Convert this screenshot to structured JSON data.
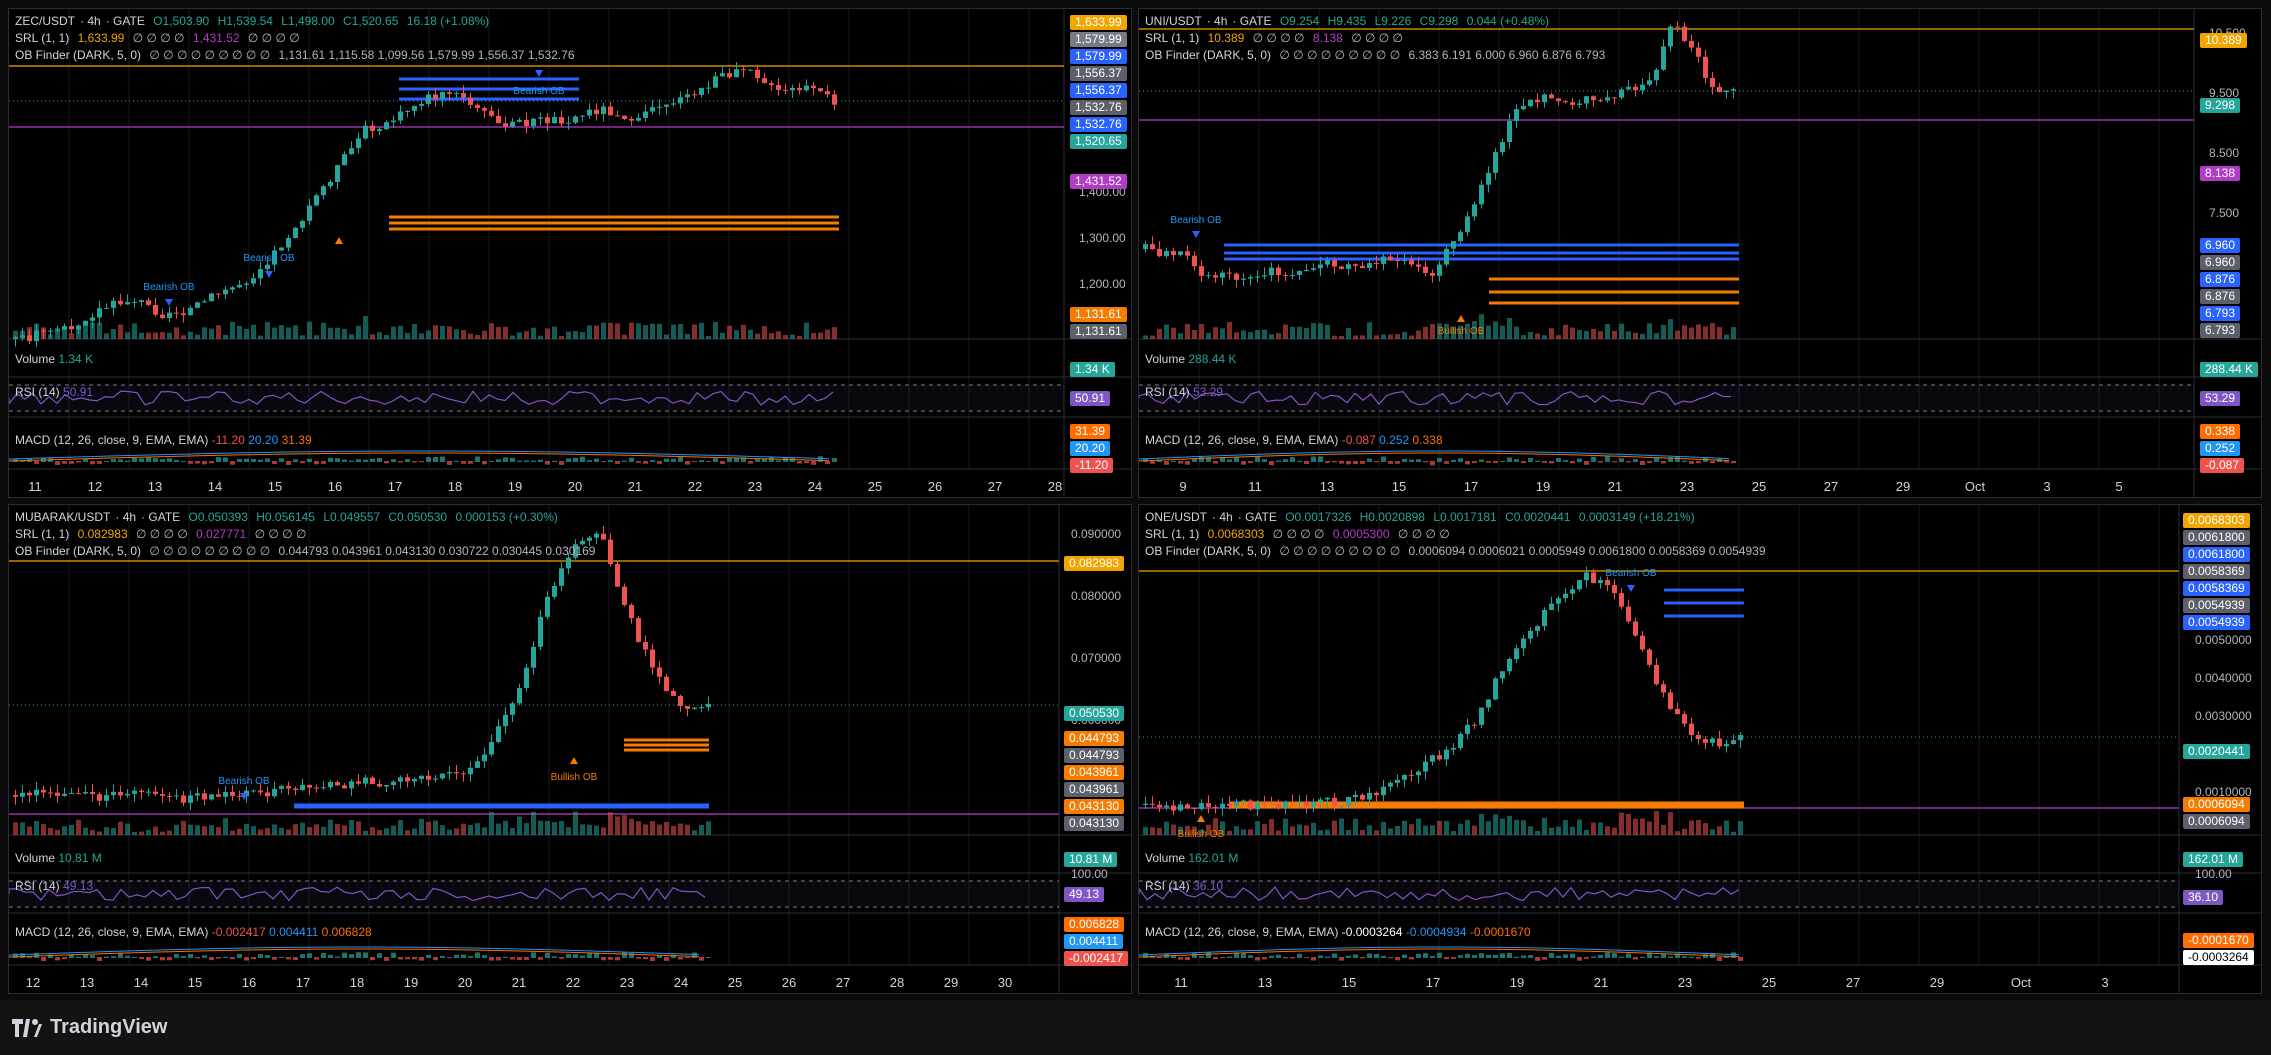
{
  "footer": {
    "brand": "TradingView"
  },
  "colors": {
    "up": "#26a69a",
    "down": "#ef5350",
    "bg": "#000000",
    "srl_top": "#f0a500",
    "srl_bot": "#b23cc8",
    "ob_bear": "#2962ff",
    "ob_bull": "#f57c00",
    "rsi": "#7e57c2",
    "macd": "#2196f3",
    "signal": "#ff6d00"
  },
  "panels": [
    {
      "id": "zec",
      "legend": {
        "symbol": "ZEC/USDT",
        "interval": "4h",
        "exchange": "GATE",
        "o": "O1,503.90",
        "h": "H1,539.54",
        "l": "L1,498.00",
        "c": "C1,520.65",
        "chg": "16.18 (+1.08%)",
        "srl_name": "SRL (1, 1)",
        "srl_v1": "1,633.99",
        "srl_nan1": "∅ ∅ ∅ ∅",
        "srl_v2": "1,431.52",
        "srl_nan2": "∅ ∅ ∅ ∅",
        "ob_name": "OB Finder (DARK, 5, 0)",
        "ob_nans": "∅ ∅ ∅ ∅ ∅ ∅ ∅ ∅ ∅",
        "ob_values": "1,131.61  1,115.58  1,099.56  1,579.99  1,556.37  1,532.76"
      },
      "yticks": [
        "1,400.00",
        "1,300.00",
        "1,200.00"
      ],
      "price_labels": [
        {
          "text": "1,633.99",
          "bg": "#f0a500"
        },
        {
          "text": "1,579.99",
          "bg": "#787b86"
        },
        {
          "text": "1,579.99",
          "bg": "#2962ff"
        },
        {
          "text": "1,556.37",
          "bg": "#5d606b"
        },
        {
          "text": "1,556.37",
          "bg": "#2962ff"
        },
        {
          "text": "1,532.76",
          "bg": "#5d606b"
        },
        {
          "text": "1,532.76",
          "bg": "#2962ff"
        },
        {
          "text": "1,520.65",
          "bg": "#26a69a"
        },
        {
          "text": "1,431.52",
          "bg": "#b23cc8"
        },
        {
          "text": "1,131.61",
          "bg": "#f57c00"
        },
        {
          "text": "1,131.61",
          "bg": "#5d606b"
        }
      ],
      "xticks": [
        "11",
        "12",
        "13",
        "14",
        "15",
        "16",
        "17",
        "18",
        "19",
        "20",
        "21",
        "22",
        "23",
        "24",
        "25",
        "26",
        "27",
        "28"
      ],
      "volume": {
        "name": "Volume",
        "value": "1.34 K",
        "label": "1.34 K"
      },
      "rsi": {
        "name": "RSI (14)",
        "value": "50.91",
        "label": "50.91"
      },
      "macd": {
        "name": "MACD (12, 26, close, 9, EMA, EMA)",
        "v1": "-11.20",
        "v2": "20.20",
        "v3": "31.39",
        "labels": [
          {
            "text": "31.39",
            "bg": "#ff6d00"
          },
          {
            "text": "20.20",
            "bg": "#2196f3"
          },
          {
            "text": "-11.20",
            "bg": "#ef5350"
          }
        ]
      },
      "ob_texts": [
        {
          "text": "Bearish OB",
          "kind": "bear"
        },
        {
          "text": "Bearish OB",
          "kind": "bear"
        },
        {
          "text": "Bearish OB",
          "kind": "bear"
        }
      ]
    },
    {
      "id": "uni",
      "legend": {
        "symbol": "UNI/USDT",
        "interval": "4h",
        "exchange": "GATE",
        "o": "O9.254",
        "h": "H9.435",
        "l": "L9.226",
        "c": "C9.298",
        "chg": "0.044 (+0.48%)",
        "srl_name": "SRL (1, 1)",
        "srl_v1": "10.389",
        "srl_nan1": "∅ ∅ ∅ ∅",
        "srl_v2": "8.138",
        "srl_nan2": "∅ ∅ ∅ ∅",
        "ob_name": "OB Finder (DARK, 5, 0)",
        "ob_nans": "∅ ∅ ∅ ∅ ∅ ∅ ∅ ∅ ∅",
        "ob_values": "6.383  6.191  6.000  6.960  6.876  6.793"
      },
      "yticks": [
        "10.500",
        "9.500",
        "8.500",
        "7.500"
      ],
      "price_labels": [
        {
          "text": "10.389",
          "bg": "#f0a500"
        },
        {
          "text": "9.298",
          "bg": "#26a69a"
        },
        {
          "text": "8.138",
          "bg": "#b23cc8"
        },
        {
          "text": "6.960",
          "bg": "#2962ff"
        },
        {
          "text": "6.960",
          "bg": "#5d606b"
        },
        {
          "text": "6.876",
          "bg": "#2962ff"
        },
        {
          "text": "6.876",
          "bg": "#5d606b"
        },
        {
          "text": "6.793",
          "bg": "#2962ff"
        },
        {
          "text": "6.793",
          "bg": "#5d606b"
        }
      ],
      "xticks": [
        "9",
        "11",
        "13",
        "15",
        "17",
        "19",
        "21",
        "23",
        "25",
        "27",
        "29",
        "Oct",
        "3",
        "5"
      ],
      "volume": {
        "name": "Volume",
        "value": "288.44 K",
        "label": "288.44 K"
      },
      "rsi": {
        "name": "RSI (14)",
        "value": "53.29",
        "label": "53.29"
      },
      "macd": {
        "name": "MACD (12, 26, close, 9, EMA, EMA)",
        "v1": "-0.087",
        "v2": "0.252",
        "v3": "0.338",
        "labels": [
          {
            "text": "0.338",
            "bg": "#ff6d00"
          },
          {
            "text": "0.252",
            "bg": "#2196f3"
          },
          {
            "text": "-0.087",
            "bg": "#ef5350"
          }
        ]
      },
      "ob_texts": [
        {
          "text": "Bearish OB",
          "kind": "bear"
        },
        {
          "text": "Bullish OB",
          "kind": "bull"
        }
      ]
    },
    {
      "id": "mubarak",
      "legend": {
        "symbol": "MUBARAK/USDT",
        "interval": "4h",
        "exchange": "GATE",
        "o": "O0.050393",
        "h": "H0.056145",
        "l": "L0.049557",
        "c": "C0.050530",
        "chg": "0.000153 (+0.30%)",
        "srl_name": "SRL (1, 1)",
        "srl_v1": "0.082983",
        "srl_nan1": "∅ ∅ ∅ ∅",
        "srl_v2": "0.027771",
        "srl_nan2": "∅ ∅ ∅ ∅",
        "ob_name": "OB Finder (DARK, 5, 0)",
        "ob_nans": "∅ ∅ ∅ ∅ ∅ ∅ ∅ ∅ ∅",
        "ob_values": "0.044793  0.043961  0.043130  0.030722  0.030445  0.030169"
      },
      "yticks": [
        "0.090000",
        "0.080000",
        "0.070000",
        "0.060000"
      ],
      "price_labels": [
        {
          "text": "0.082983",
          "bg": "#f0a500"
        },
        {
          "text": "0.050530",
          "bg": "#26a69a"
        },
        {
          "text": "0.044793",
          "bg": "#f57c00"
        },
        {
          "text": "0.044793",
          "bg": "#5d606b"
        },
        {
          "text": "0.043961",
          "bg": "#f57c00"
        },
        {
          "text": "0.043961",
          "bg": "#5d606b"
        },
        {
          "text": "0.043130",
          "bg": "#f57c00"
        },
        {
          "text": "0.043130",
          "bg": "#5d606b"
        }
      ],
      "xticks": [
        "12",
        "13",
        "14",
        "15",
        "16",
        "17",
        "18",
        "19",
        "20",
        "21",
        "22",
        "23",
        "24",
        "25",
        "26",
        "27",
        "28",
        "29",
        "30"
      ],
      "volume": {
        "name": "Volume",
        "value": "10.81 M",
        "label": "10.81 M"
      },
      "rsi": {
        "name": "RSI (14)",
        "value": "49.13",
        "label": "49.13",
        "tick": "100.00"
      },
      "macd": {
        "name": "MACD (12, 26, close, 9, EMA, EMA)",
        "v1": "-0.002417",
        "v2": "0.004411",
        "v3": "0.006828",
        "labels": [
          {
            "text": "0.006828",
            "bg": "#ff6d00"
          },
          {
            "text": "0.004411",
            "bg": "#2196f3"
          },
          {
            "text": "-0.002417",
            "bg": "#ef5350"
          }
        ]
      },
      "ob_texts": [
        {
          "text": "Bearish OB",
          "kind": "bear"
        },
        {
          "text": "Bullish OB",
          "kind": "bull"
        }
      ]
    },
    {
      "id": "one",
      "legend": {
        "symbol": "ONE/USDT",
        "interval": "4h",
        "exchange": "GATE",
        "o": "O0.0017326",
        "h": "H0.0020898",
        "l": "L0.0017181",
        "c": "C0.0020441",
        "chg": "0.0003149 (+18.21%)",
        "srl_name": "SRL (1, 1)",
        "srl_v1": "0.0068303",
        "srl_nan1": "∅ ∅ ∅ ∅",
        "srl_v2": "0.0005300",
        "srl_nan2": "∅ ∅ ∅ ∅",
        "ob_name": "OB Finder (DARK, 5, 0)",
        "ob_nans": "∅ ∅ ∅ ∅ ∅ ∅ ∅ ∅ ∅",
        "ob_values": "0.0006094  0.0006021  0.0005949  0.0061800  0.0058369  0.0054939"
      },
      "yticks": [
        "0.0050000",
        "0.0040000",
        "0.0030000",
        "0.0010000"
      ],
      "price_labels": [
        {
          "text": "0.0068303",
          "bg": "#f0a500"
        },
        {
          "text": "0.0061800",
          "bg": "#5d606b"
        },
        {
          "text": "0.0061800",
          "bg": "#2962ff"
        },
        {
          "text": "0.0058369",
          "bg": "#5d606b"
        },
        {
          "text": "0.0058369",
          "bg": "#2962ff"
        },
        {
          "text": "0.0054939",
          "bg": "#5d606b"
        },
        {
          "text": "0.0054939",
          "bg": "#2962ff"
        },
        {
          "text": "0.0020441",
          "bg": "#26a69a"
        },
        {
          "text": "0.0006094",
          "bg": "#f57c00"
        },
        {
          "text": "0.0006094",
          "bg": "#5d606b"
        }
      ],
      "xticks": [
        "11",
        "13",
        "15",
        "17",
        "19",
        "21",
        "23",
        "25",
        "27",
        "29",
        "Oct",
        "3"
      ],
      "volume": {
        "name": "Volume",
        "value": "162.01 M",
        "label": "162.01 M"
      },
      "rsi": {
        "name": "RSI (14)",
        "value": "36.10",
        "label": "36.10",
        "tick": "100.00"
      },
      "macd": {
        "name": "MACD (12, 26, close, 9, EMA, EMA)",
        "v1": "-0.0003264",
        "v2": "-0.0004934",
        "v3": "-0.0001670",
        "labels": [
          {
            "text": "-0.0001670",
            "bg": "#ff6d00"
          },
          {
            "text": "-0.0003264",
            "bg": "#ffffff"
          }
        ]
      },
      "ob_texts": [
        {
          "text": "Bearish OB",
          "kind": "bear"
        },
        {
          "text": "Bullish OB",
          "kind": "bull"
        }
      ]
    }
  ]
}
